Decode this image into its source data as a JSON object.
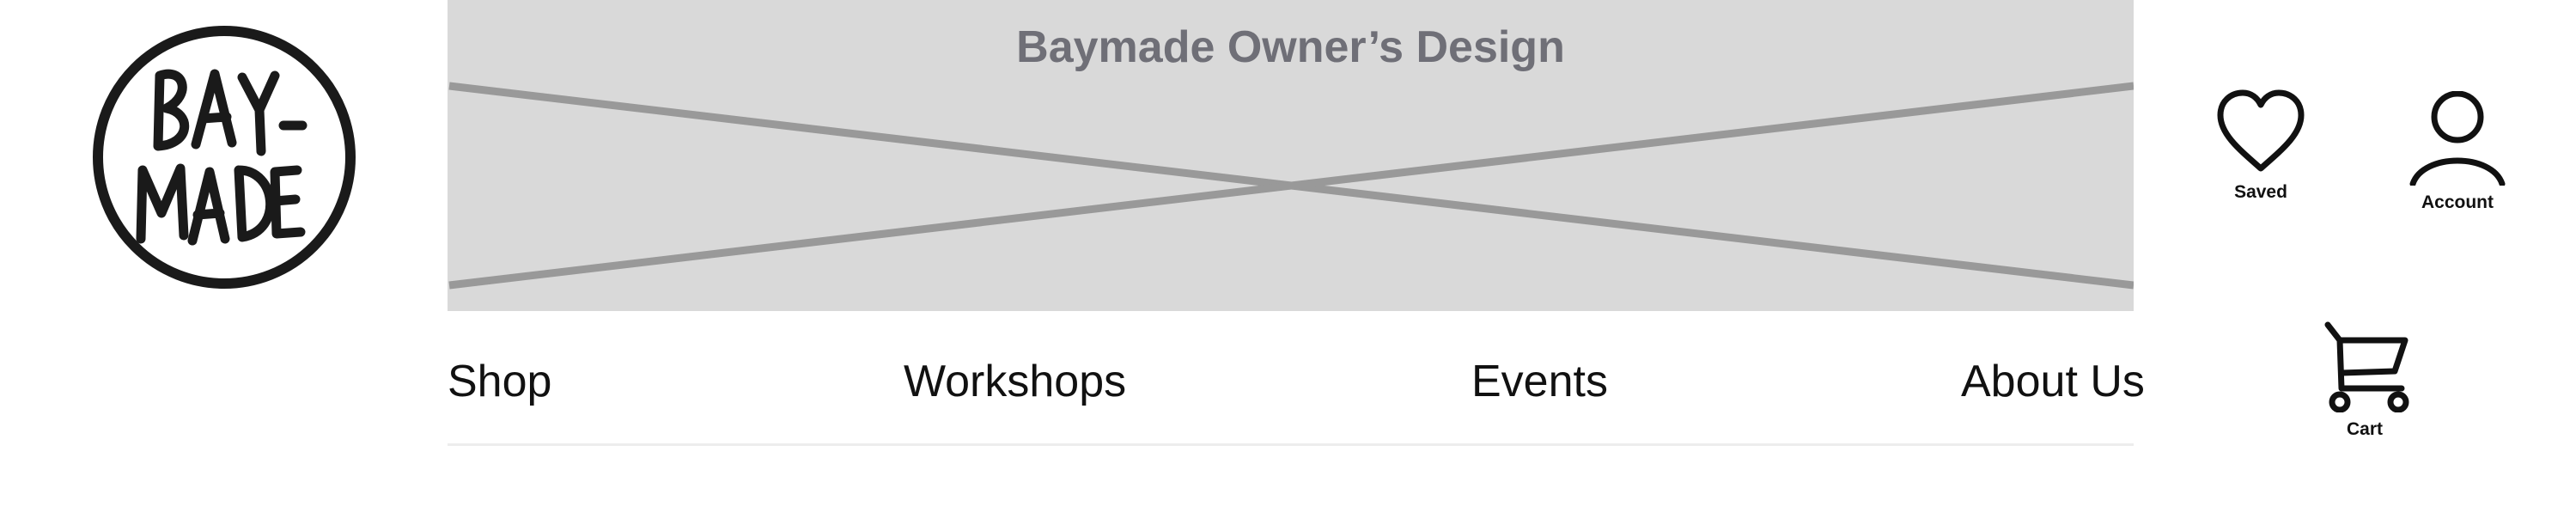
{
  "brand": {
    "logo_line1": "BAY-",
    "logo_line2": "MADE"
  },
  "banner": {
    "title": "Baymade Owner’s Design"
  },
  "nav": {
    "items": [
      {
        "label": "Shop"
      },
      {
        "label": "Workshops"
      },
      {
        "label": "Events"
      },
      {
        "label": "About Us"
      }
    ]
  },
  "utility": {
    "saved_label": "Saved",
    "account_label": "Account",
    "cart_label": "Cart"
  },
  "colors": {
    "banner_bg": "#d9d9d9",
    "banner_cross": "#999999",
    "banner_title": "#6f6f77",
    "text": "#111111"
  },
  "icons": {
    "saved": "heart-icon",
    "account": "user-icon",
    "cart": "cart-icon"
  }
}
